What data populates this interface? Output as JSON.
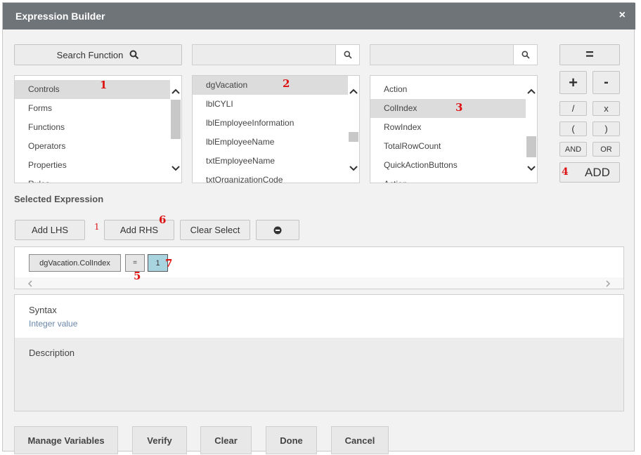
{
  "dialog": {
    "title": "Expression Builder",
    "close_symbol": "×"
  },
  "search": {
    "function_label": "Search Function",
    "middle_placeholder": "",
    "right_placeholder": ""
  },
  "lists": {
    "categories": [
      "Controls",
      "Forms",
      "Functions",
      "Operators",
      "Properties",
      "Rules"
    ],
    "controls": [
      "dgVacation",
      "lblCYLI",
      "lblEmployeeInformation",
      "lblEmployeeName",
      "txtEmployeeName",
      "txtOrganizationCode"
    ],
    "properties": [
      "Action",
      "ColIndex",
      "RowIndex",
      "TotalRowCount",
      "QuickActionButtons",
      "Action"
    ]
  },
  "operators": {
    "equals": "=",
    "plus": "+",
    "minus": "-",
    "divide": "/",
    "multiply": "x",
    "open_paren": "(",
    "close_paren": ")",
    "and": "AND",
    "or": "OR",
    "add": "ADD"
  },
  "selected_expression": {
    "label": "Selected Expression",
    "add_lhs": "Add LHS",
    "add_rhs": "Add RHS",
    "clear_select": "Clear Select",
    "lhs_chip": "dgVacation.ColIndex",
    "op_chip": "=",
    "rhs_chip": "1"
  },
  "syntax": {
    "title": "Syntax",
    "value": "Integer value"
  },
  "description": {
    "title": "Description"
  },
  "footer": {
    "manage_variables": "Manage Variables",
    "verify": "Verify",
    "clear": "Clear",
    "done": "Done",
    "cancel": "Cancel"
  },
  "markers": {
    "m1": "1",
    "m2": "2",
    "m3": "3",
    "m4": "4",
    "m1b": "1",
    "m6": "6",
    "m5": "5",
    "m7": "7"
  },
  "colors": {
    "titlebar": "#6f7479",
    "accent_marker": "#dd1111",
    "syntax_value": "#6a86a8",
    "rhs_chip": "#a8d4e0"
  }
}
